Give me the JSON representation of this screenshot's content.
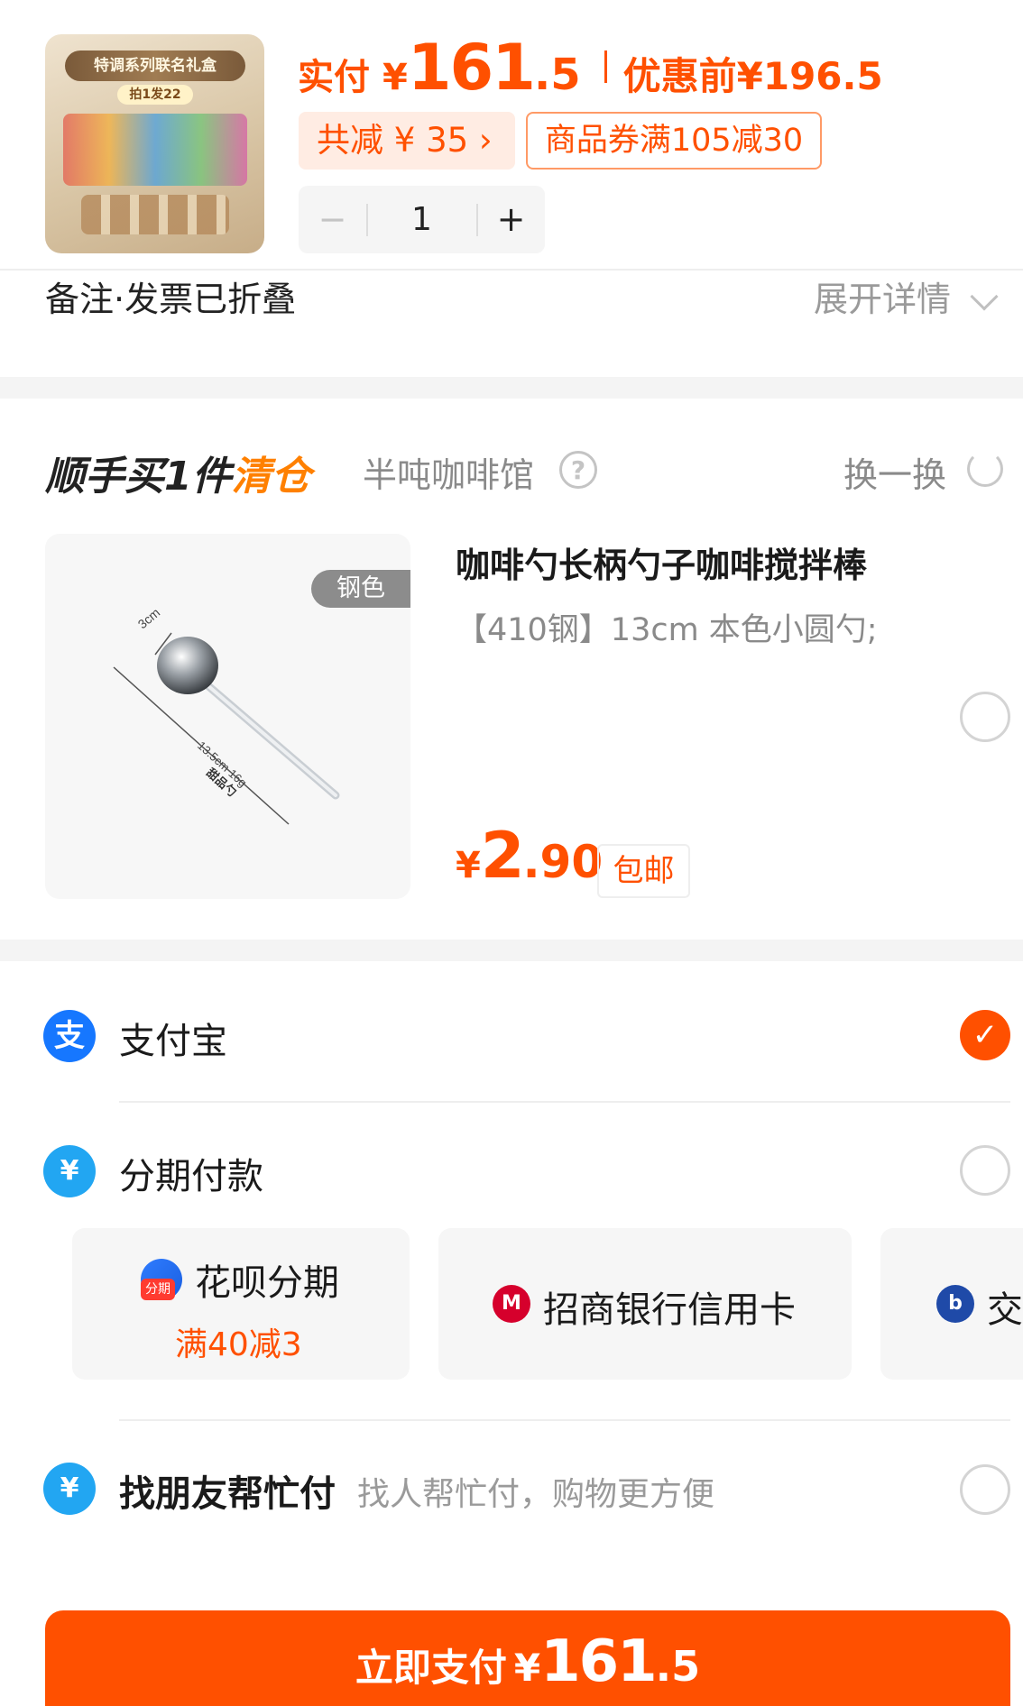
{
  "product": {
    "thumb_banner": "特调系列联名礼盒",
    "thumb_sub": "拍1发22",
    "pay_label": "实付",
    "currency": "¥",
    "pay_int": "161",
    "pay_dec": ".5",
    "pre_label": "优惠前",
    "pre_price": "¥196.5",
    "discount": "共减 ¥ 35 ›",
    "coupon": "商品券满105减30",
    "qty_minus": "−",
    "qty_value": "1",
    "qty_plus": "+"
  },
  "note": {
    "label": "备注·发票已折叠",
    "expand": "展开详情"
  },
  "addon": {
    "title_prefix": "顺手买1件",
    "title_highlight": "清仓",
    "shop": "半吨咖啡馆",
    "help_glyph": "?",
    "swap": "换一换",
    "tag": "钢色",
    "img_width_label": "3cm",
    "img_length_label": "13.5cm 16g",
    "img_name_label": "甜品勺",
    "title": "咖啡勺长柄勺子咖啡搅拌棒",
    "spec": "【410钢】13cm 本色小圆勺;",
    "price_yen": "¥",
    "price_int": "2",
    "price_dec": ".90",
    "shipping": "包邮"
  },
  "payment": {
    "alipay_label": "支付宝",
    "alipay_glyph": "支",
    "installment_label": "分期付款",
    "installment_glyph": "¥",
    "options": [
      {
        "name": "花呗分期",
        "promo": "满40减3",
        "badge": "分期"
      },
      {
        "name": "招商银行信用卡",
        "glyph": "M"
      },
      {
        "name": "交",
        "glyph": "b"
      }
    ],
    "friend_label": "找朋友帮忙付",
    "friend_sub": "找人帮忙付，购物更方便",
    "friend_glyph": "¥",
    "check_glyph": "✓"
  },
  "pay_button": {
    "label": "立即支付",
    "yen": "¥",
    "int": "161",
    "dec": ".5"
  },
  "colors": {
    "accent": "#ff5000",
    "alipay_blue": "#1677ff"
  }
}
